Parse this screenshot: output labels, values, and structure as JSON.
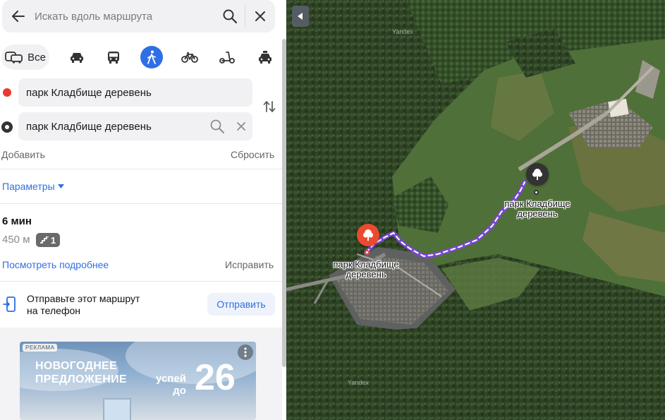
{
  "search": {
    "placeholder": "Искать вдоль маршрута"
  },
  "icons": {
    "back": "arrow-left-icon",
    "search": "search-icon",
    "close": "close-icon",
    "swap": "swap-arrows-icon",
    "phone": "phone-send-icon"
  },
  "transport_modes": [
    {
      "id": "all",
      "label": "Все",
      "icon": "all-transport-icon"
    },
    {
      "id": "car",
      "label": "",
      "icon": "car-icon"
    },
    {
      "id": "bus",
      "label": "",
      "icon": "bus-icon"
    },
    {
      "id": "walk",
      "label": "",
      "icon": "pedestrian-icon",
      "selected": true
    },
    {
      "id": "bike",
      "label": "",
      "icon": "bicycle-icon"
    },
    {
      "id": "scooter",
      "label": "",
      "icon": "scooter-icon"
    },
    {
      "id": "taxi",
      "label": "",
      "icon": "taxi-icon"
    }
  ],
  "route_points": {
    "from": "парк Кладбище деревень",
    "to": "парк Кладбище деревень"
  },
  "actions": {
    "add": "Добавить",
    "reset": "Сбросить"
  },
  "params": {
    "label": "Параметры"
  },
  "route": {
    "time": "6 мин",
    "distance": "450 м",
    "stairs_count": "1",
    "details_link": "Посмотреть подробнее",
    "fix_link": "Исправить"
  },
  "send": {
    "text_line1": "Отправьте этот маршрут",
    "text_line2": "на телефон",
    "button": "Отправить"
  },
  "ad": {
    "badge": "РЕКЛАМА",
    "line1": "НОВОГОДНЕЕ",
    "line2": "ПРЕДЛОЖЕНИЕ",
    "small1": "успей",
    "small2": "до",
    "big": "26"
  },
  "map": {
    "label_start_line1": "парк Кладбище",
    "label_start_line2": "деревень",
    "label_end_line1": "парк Кладбище",
    "label_end_line2": "деревень",
    "watermark": "Yandex",
    "route_color": "#7b46d9",
    "pin_start_color": "#ea4a2f",
    "pin_end_color": "#333333"
  },
  "colors": {
    "accent": "#2f6fe4",
    "start_dot": "#ea3a2f"
  }
}
